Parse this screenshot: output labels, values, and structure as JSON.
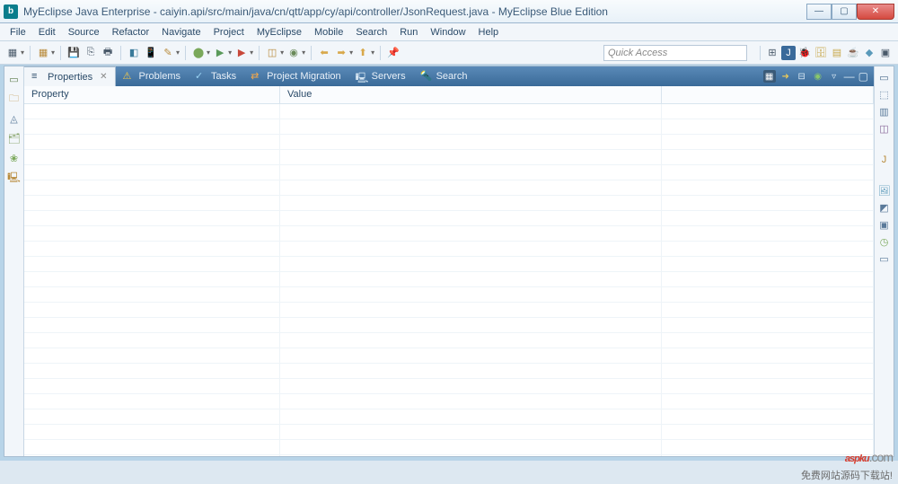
{
  "window": {
    "title": "MyEclipse Java Enterprise - caiyin.api/src/main/java/cn/qtt/app/cy/api/controller/JsonRequest.java - MyEclipse Blue Edition",
    "app_icon_letter": "b"
  },
  "menubar": {
    "items": [
      "File",
      "Edit",
      "Source",
      "Refactor",
      "Navigate",
      "Project",
      "MyEclipse",
      "Mobile",
      "Search",
      "Run",
      "Window",
      "Help"
    ]
  },
  "toolbar": {
    "quick_access_placeholder": "Quick Access"
  },
  "views": {
    "tabs": [
      {
        "label": "Properties",
        "active": true,
        "icon": "properties-icon"
      },
      {
        "label": "Problems",
        "active": false,
        "icon": "problems-icon"
      },
      {
        "label": "Tasks",
        "active": false,
        "icon": "tasks-icon"
      },
      {
        "label": "Project Migration",
        "active": false,
        "icon": "migration-icon"
      },
      {
        "label": "Servers",
        "active": false,
        "icon": "servers-icon"
      },
      {
        "label": "Search",
        "active": false,
        "icon": "search-icon"
      }
    ]
  },
  "properties": {
    "columns": {
      "property": "Property",
      "value": "Value",
      "extra": ""
    },
    "rows": []
  },
  "watermark": {
    "brand": "aspku",
    "suffix": ".com",
    "subtitle": "免费网站源码下载站!"
  }
}
